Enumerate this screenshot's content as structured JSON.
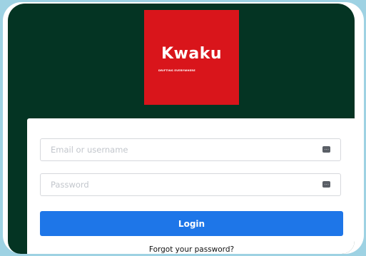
{
  "brand": {
    "name": "Kwaku",
    "tagline": "DRIFTING EVERYWHERE",
    "logo_color": "#d9151b"
  },
  "theme": {
    "screen_background": "#043423",
    "accent": "#1e76e8",
    "outer_background": "#9ed2e3"
  },
  "login_form": {
    "email_placeholder": "Email or username",
    "password_placeholder": "Password",
    "field_icon": "password-manager-key-icon",
    "login_label": "Login",
    "forgot_label": "Forgot your password?"
  }
}
